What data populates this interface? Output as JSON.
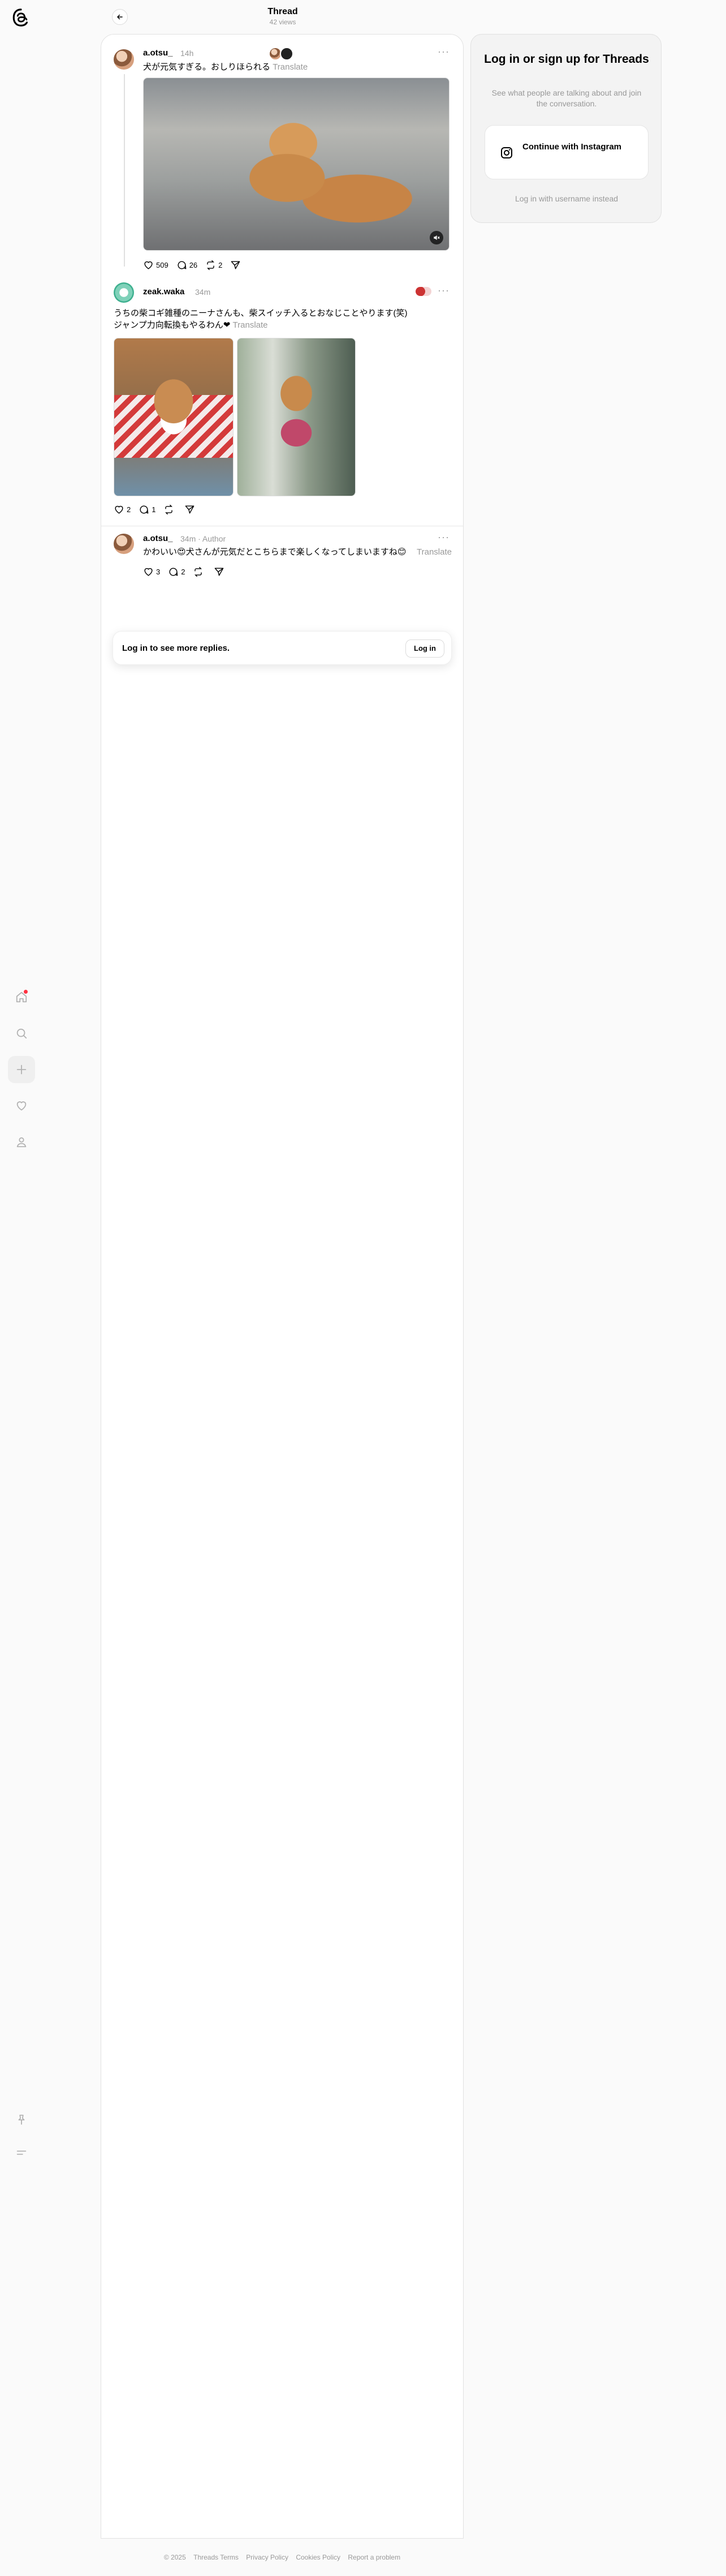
{
  "header": {
    "title": "Thread",
    "subtitle": "42 views"
  },
  "posts": [
    {
      "username": "a.otsu_",
      "time": "14h",
      "text": "犬が元気すぎる。おしりほられる",
      "translate": "Translate",
      "likes": "509",
      "comments": "26",
      "reposts": "2"
    },
    {
      "username": "zeak.waka",
      "time": "34m",
      "text_line1": "うちの柴コギ雑種のニーナさんも、柴スイッチ入るとおなじことやります(笑)",
      "text_line2": "ジャンプ力向転換もやるわん❤",
      "translate": "Translate",
      "likes": "2",
      "comments": "1"
    },
    {
      "username": "a.otsu_",
      "time": "34m",
      "author_badge": "Author",
      "text": "かわいい😍犬さんが元気だとこちらまで楽しくなってしまいますね😊",
      "translate": "Translate",
      "likes": "3",
      "comments": "2"
    }
  ],
  "login_more": {
    "text": "Log in to see more replies.",
    "button": "Log in"
  },
  "panel": {
    "title": "Log in or sign up for Threads",
    "desc": "See what people are talking about and join the conversation.",
    "instagram_button": "Continue with Instagram",
    "alt_login": "Log in with username instead"
  },
  "footer": {
    "copyright": "© 2025",
    "links": [
      "Threads Terms",
      "Privacy Policy",
      "Cookies Policy",
      "Report a problem"
    ]
  },
  "icons": {
    "logo": "threads-logo-icon",
    "nav": [
      "home-icon",
      "search-icon",
      "plus-icon",
      "heart-icon",
      "profile-icon"
    ],
    "bottom": [
      "pin-icon",
      "menu-icon"
    ]
  },
  "colors": {
    "notification_dot": "#ff3040",
    "muted_text": "#999999"
  }
}
